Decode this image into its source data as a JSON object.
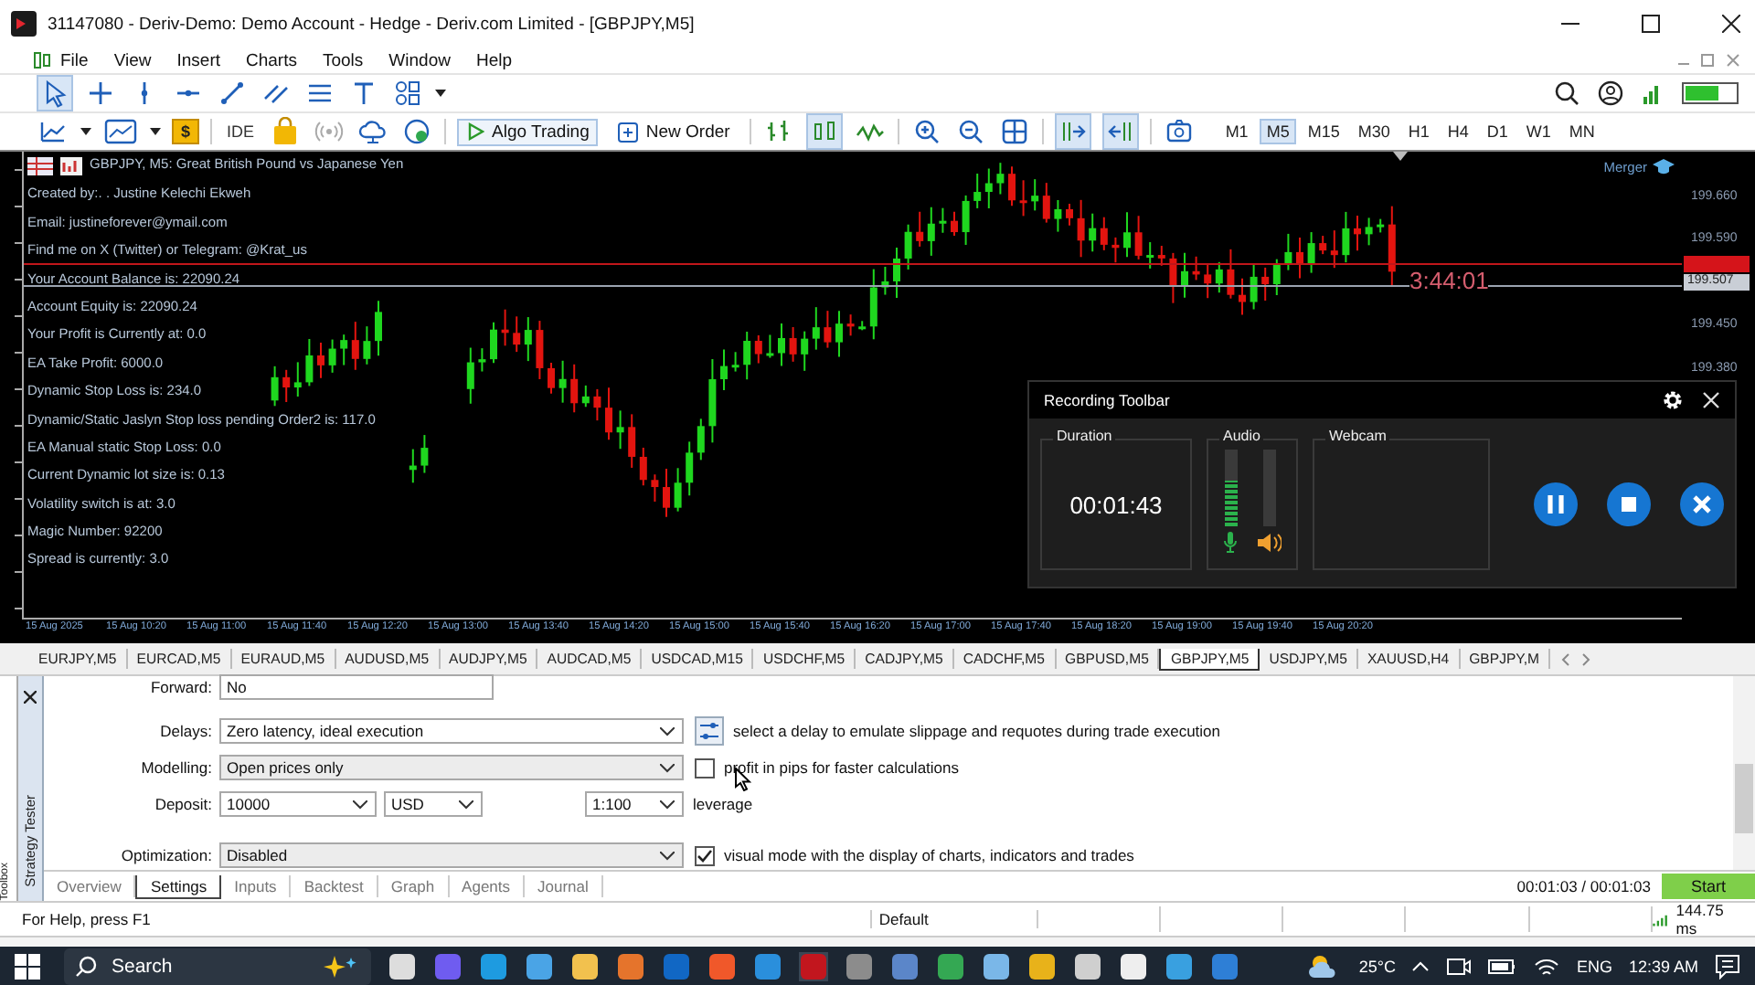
{
  "window": {
    "title": "31147080 - Deriv-Demo: Demo Account - Hedge - Deriv.com Limited - [GBPJPY,M5]"
  },
  "menu": [
    "File",
    "View",
    "Insert",
    "Charts",
    "Tools",
    "Window",
    "Help"
  ],
  "toolbar": {
    "dollar": "$",
    "ide": "IDE",
    "algo_trading": "Algo Trading",
    "new_order": "New Order",
    "timeframes": [
      {
        "label": "M1",
        "selected": false
      },
      {
        "label": "M5",
        "selected": true
      },
      {
        "label": "M15",
        "selected": false
      },
      {
        "label": "M30",
        "selected": false
      },
      {
        "label": "H1",
        "selected": false
      },
      {
        "label": "H4",
        "selected": false
      },
      {
        "label": "D1",
        "selected": false
      },
      {
        "label": "W1",
        "selected": false
      },
      {
        "label": "MN",
        "selected": false
      }
    ]
  },
  "chart": {
    "header": "GBPJPY, M5:  Great British Pound vs Japanese Yen",
    "info_lines": [
      "Created by:. .  Justine Kelechi Ekweh",
      "Email:  justineforever@ymail.com",
      "Find me on X (Twitter) or Telegram:  @Krat_us",
      "Your Account Balance is: 22090.24",
      "Account Equity is: 22090.24",
      "Your Profit is Currently at: 0.0",
      "EA Take Profit: 6000.0",
      "Dynamic Stop Loss is:  234.0",
      "Dynamic/Static Jaslyn Stop loss pending Order2 is: 117.0",
      "EA Manual static Stop Loss: 0.0",
      "Current Dynamic lot size is: 0.13",
      "Volatility switch is at: 3.0",
      "Magic Number: 92200",
      "Spread is currently: 3.0"
    ],
    "merger": "Merger",
    "countdown": "3:44:01",
    "bid_label": "199.507",
    "price_labels": [
      "199.660",
      "199.590",
      "199.450",
      "199.380"
    ],
    "time_labels": [
      "15 Aug 2025",
      "15 Aug 10:20",
      "15 Aug 11:00",
      "15 Aug 11:40",
      "15 Aug 12:20",
      "15 Aug 13:00",
      "15 Aug 13:40",
      "15 Aug 14:20",
      "15 Aug 15:00",
      "15 Aug 15:40",
      "15 Aug 16:20",
      "15 Aug 17:00",
      "15 Aug 17:40",
      "15 Aug 18:20",
      "15 Aug 19:00",
      "15 Aug 19:40",
      "15 Aug 20:20"
    ]
  },
  "recording_toolbar": {
    "title": "Recording Toolbar",
    "duration_label": "Duration",
    "duration": "00:01:43",
    "audio_label": "Audio",
    "mic": {
      "level": 0.6
    },
    "speaker": {
      "level": 0
    },
    "webcam_label": "Webcam"
  },
  "symbol_tabs": [
    {
      "label": "EURJPY,M5",
      "selected": false
    },
    {
      "label": "EURCAD,M5",
      "selected": false
    },
    {
      "label": "EURAUD,M5",
      "selected": false
    },
    {
      "label": "AUDUSD,M5",
      "selected": false
    },
    {
      "label": "AUDJPY,M5",
      "selected": false
    },
    {
      "label": "AUDCAD,M5",
      "selected": false
    },
    {
      "label": "USDCAD,M15",
      "selected": false
    },
    {
      "label": "USDCHF,M5",
      "selected": false
    },
    {
      "label": "CADJPY,M5",
      "selected": false
    },
    {
      "label": "CADCHF,M5",
      "selected": false
    },
    {
      "label": "GBPUSD,M5",
      "selected": false
    },
    {
      "label": "GBPJPY,M5",
      "selected": true
    },
    {
      "label": "USDJPY,M5",
      "selected": false
    },
    {
      "label": "XAUUSD,H4",
      "selected": false
    },
    {
      "label": "GBPJPY,M",
      "selected": false
    }
  ],
  "tester": {
    "side_label": "Strategy Tester",
    "toolbox_label": "Toolbox",
    "forward_label": "Forward:",
    "forward": "No",
    "delays_label": "Delays:",
    "delays": "Zero latency, ideal execution",
    "delays_hint": "select a delay to emulate slippage and requotes during trade execution",
    "modelling_label": "Modelling:",
    "modelling": "Open prices only",
    "pips": {
      "label": "profit in pips for faster calculations",
      "checked": false
    },
    "deposit_label": "Deposit:",
    "deposit": "10000",
    "currency": "USD",
    "leverage": "1:100",
    "leverage_label": "leverage",
    "optimization_label": "Optimization:",
    "optimization": "Disabled",
    "visual": {
      "label": "visual mode with the display of charts, indicators and trades",
      "checked": true
    },
    "tabs": [
      {
        "label": "Overview",
        "selected": false
      },
      {
        "label": "Settings",
        "selected": true
      },
      {
        "label": "Inputs",
        "selected": false
      },
      {
        "label": "Backtest",
        "selected": false
      },
      {
        "label": "Graph",
        "selected": false
      },
      {
        "label": "Agents",
        "selected": false
      },
      {
        "label": "Journal",
        "selected": false
      }
    ],
    "progress": "00:01:03 / 00:01:03",
    "start": "Start"
  },
  "status_bar": {
    "help": "For Help, press F1",
    "profile": "Default",
    "ping": "144.75 ms"
  },
  "taskbar": {
    "search": "Search",
    "temperature": "25°C",
    "language": "ENG",
    "time": "12:39 AM"
  }
}
